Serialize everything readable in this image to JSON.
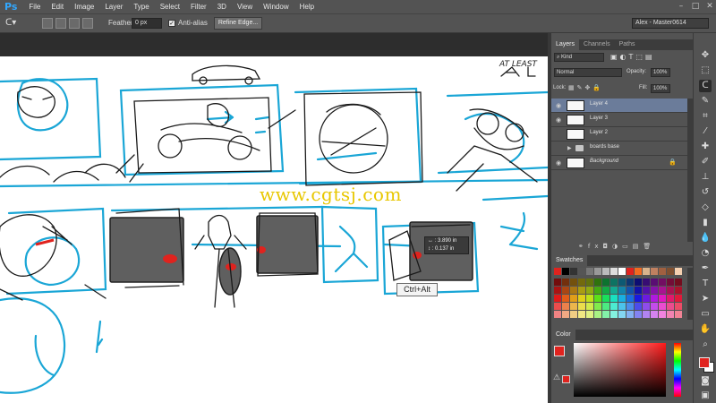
{
  "app": {
    "logo": "Ps",
    "menu": [
      "File",
      "Edit",
      "Image",
      "Layer",
      "Type",
      "Select",
      "Filter",
      "3D",
      "View",
      "Window",
      "Help"
    ]
  },
  "options_bar": {
    "feather_label": "Feather:",
    "feather_value": "0 px",
    "antialias_label": "Anti-alias",
    "antialias_checked": true,
    "refine_edge_label": "Refine Edge...",
    "workspace": "Alex - Master0614"
  },
  "canvas": {
    "watermark": "www.cgtsj.com",
    "sketch_text": "AT LEAST",
    "tooltip": "Ctrl+Alt",
    "measure": [
      "↔ : 3.890 in",
      "↕ : 0.137 in"
    ],
    "colors": {
      "cyan": "#1aa6d6",
      "ink": "#1a1a1a",
      "red": "#e0231e",
      "grey": "#5f5f5f"
    }
  },
  "layers_panel": {
    "tabs": [
      "Layers",
      "Channels",
      "Paths"
    ],
    "filter": "Kind",
    "blend_mode": "Normal",
    "opacity_label": "Opacity:",
    "opacity_value": "100%",
    "lock_label": "Lock:",
    "fill_label": "Fill:",
    "fill_value": "100%",
    "layers": [
      {
        "name": "Layer 4",
        "visible": true,
        "selected": true
      },
      {
        "name": "Layer 3",
        "visible": true,
        "selected": false
      },
      {
        "name": "Layer 2",
        "visible": false,
        "selected": false
      },
      {
        "name": "boards base",
        "visible": false,
        "selected": false,
        "group": true
      },
      {
        "name": "Background",
        "visible": true,
        "selected": false,
        "locked": true
      }
    ]
  },
  "swatches_panel": {
    "title": "Swatches"
  },
  "color_panel": {
    "title": "Color",
    "foreground": "#e0231e",
    "background": "#ffffff"
  }
}
